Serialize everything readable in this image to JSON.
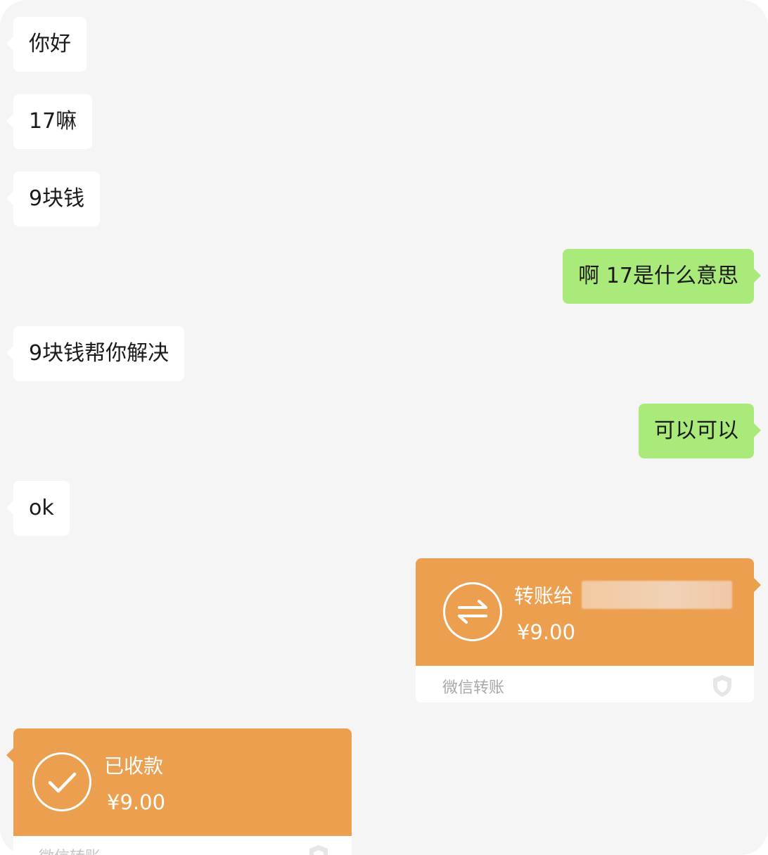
{
  "messages": [
    {
      "side": "in",
      "text": "你好"
    },
    {
      "side": "in",
      "text": "17嘛"
    },
    {
      "side": "in",
      "text": "9块钱"
    },
    {
      "side": "out",
      "text": "啊 17是什么意思"
    },
    {
      "side": "in",
      "text": "9块钱帮你解决"
    },
    {
      "side": "out",
      "text": "可以可以"
    },
    {
      "side": "in",
      "text": "ok"
    }
  ],
  "transfer_sent": {
    "title": "转账给",
    "amount": "¥9.00",
    "brand": "微信转账",
    "icon": "transfer-arrows-icon",
    "color": "#ec9f4f"
  },
  "transfer_received": {
    "title": "已收款",
    "amount": "¥9.00",
    "brand": "微信转账",
    "icon": "check-icon",
    "color": "#ec9f4f"
  },
  "colors": {
    "background": "#f5f5f5",
    "incoming_bubble": "#ffffff",
    "outgoing_bubble": "#a9ea7a"
  }
}
